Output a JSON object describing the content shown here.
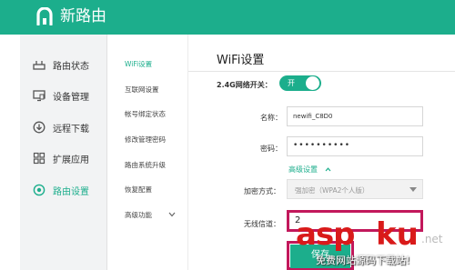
{
  "header": {
    "brand": "新路由",
    "bg_color": "#1cae8c",
    "logo_icon": "newifi-logo-icon"
  },
  "sidebar": {
    "items": [
      {
        "label": "路由状态",
        "icon": "router-icon",
        "active": false
      },
      {
        "label": "设备管理",
        "icon": "monitor-icon",
        "active": false
      },
      {
        "label": "远程下载",
        "icon": "download-icon",
        "active": false
      },
      {
        "label": "扩展应用",
        "icon": "apps-grid-icon",
        "active": false
      },
      {
        "label": "路由设置",
        "icon": "settings-gear-icon",
        "active": true
      }
    ]
  },
  "subnav": {
    "items": [
      {
        "label": "WiFi设置",
        "active": true
      },
      {
        "label": "互联网设置",
        "active": false
      },
      {
        "label": "帐号绑定状态",
        "active": false
      },
      {
        "label": "修改管理密码",
        "active": false
      },
      {
        "label": "路由系统升级",
        "active": false
      },
      {
        "label": "恢复配置",
        "active": false
      },
      {
        "label": "高级功能",
        "active": false
      }
    ]
  },
  "main": {
    "title": "WiFi设置",
    "switch_label": "2.4G网络开关：",
    "switch_state": "开",
    "name_label": "名称：",
    "name_value": "newifi_C8D0",
    "password_label": "密码：",
    "password_value": "••••••••••",
    "advanced_link": "高级设置",
    "encryption_label": "加密方式：",
    "encryption_value": "强加密（WPA2个人版）",
    "channel_label": "无线信道：",
    "channel_value": "2",
    "save_label": "保存"
  },
  "watermark": {
    "brand_a": "asp",
    "brand_b": "ku",
    "tld": ".net",
    "subtitle": "免费网站源码下载站!"
  },
  "colors": {
    "accent": "#1cae8c",
    "highlight": "#c2185b",
    "watermark": "#d91a1a"
  }
}
